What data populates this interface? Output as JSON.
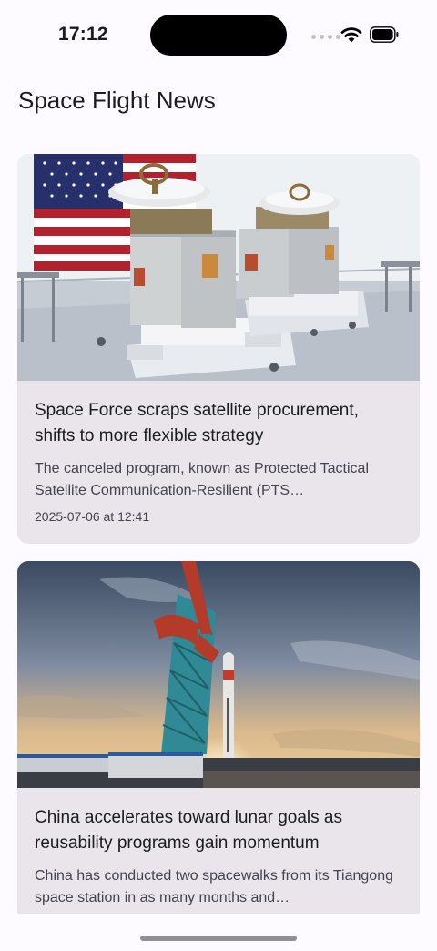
{
  "status_bar": {
    "time": "17:12"
  },
  "header": {
    "title": "Space Flight News"
  },
  "articles": [
    {
      "title": "Space Force scraps satellite procurement, shifts to more flexible strategy",
      "summary": "The canceled program, known as Protected Tactical Satellite Communication-Resilient (PTS…",
      "date": "2025-07-06 at 12:41",
      "image": "satellite-cleanroom-photo"
    },
    {
      "title": "China accelerates toward lunar goals as reusability programs gain momentum",
      "summary": "China has conducted two spacewalks from its Tiangong space station in as many months and…",
      "date": "",
      "image": "rocket-launch-tower-photo"
    }
  ],
  "colors": {
    "background": "#fdfbff",
    "card": "#e9e5eb",
    "text": "#1c1b1f",
    "secondary_text": "#45434a"
  }
}
